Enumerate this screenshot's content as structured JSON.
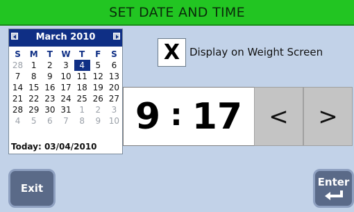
{
  "title": "SET DATE AND TIME",
  "calendar": {
    "month_label": "March 2010",
    "weekdays": [
      "S",
      "M",
      "T",
      "W",
      "T",
      "F",
      "S"
    ],
    "weeks": [
      [
        {
          "d": "28",
          "other": true
        },
        {
          "d": "1"
        },
        {
          "d": "2"
        },
        {
          "d": "3"
        },
        {
          "d": "4",
          "selected": true
        },
        {
          "d": "5"
        },
        {
          "d": "6"
        }
      ],
      [
        {
          "d": "7"
        },
        {
          "d": "8"
        },
        {
          "d": "9"
        },
        {
          "d": "10"
        },
        {
          "d": "11"
        },
        {
          "d": "12"
        },
        {
          "d": "13"
        }
      ],
      [
        {
          "d": "14"
        },
        {
          "d": "15"
        },
        {
          "d": "16"
        },
        {
          "d": "17"
        },
        {
          "d": "18"
        },
        {
          "d": "19"
        },
        {
          "d": "20"
        }
      ],
      [
        {
          "d": "21"
        },
        {
          "d": "22"
        },
        {
          "d": "23"
        },
        {
          "d": "24"
        },
        {
          "d": "25"
        },
        {
          "d": "26"
        },
        {
          "d": "27"
        }
      ],
      [
        {
          "d": "28"
        },
        {
          "d": "29"
        },
        {
          "d": "30"
        },
        {
          "d": "31"
        },
        {
          "d": "1",
          "other": true
        },
        {
          "d": "2",
          "other": true
        },
        {
          "d": "3",
          "other": true
        }
      ],
      [
        {
          "d": "4",
          "other": true
        },
        {
          "d": "5",
          "other": true
        },
        {
          "d": "6",
          "other": true
        },
        {
          "d": "7",
          "other": true
        },
        {
          "d": "8",
          "other": true
        },
        {
          "d": "9",
          "other": true
        },
        {
          "d": "10",
          "other": true
        }
      ]
    ],
    "today_label": "Today: 03/04/2010"
  },
  "display_option": {
    "check_mark": "X",
    "label": "Display on Weight Screen"
  },
  "time": {
    "hour": "9",
    "separator": ":",
    "minute": "17"
  },
  "buttons": {
    "left": "<",
    "right": ">",
    "exit": "Exit",
    "enter": "Enter"
  },
  "colors": {
    "title_bar": "#22c522",
    "background": "#c2d2e8",
    "calendar_header": "#0f2f85",
    "function_button": "#5a6a88"
  },
  "icons": {
    "enter": "return-arrow-icon",
    "cal_prev": "triangle-left-icon",
    "cal_next": "triangle-right-icon"
  }
}
